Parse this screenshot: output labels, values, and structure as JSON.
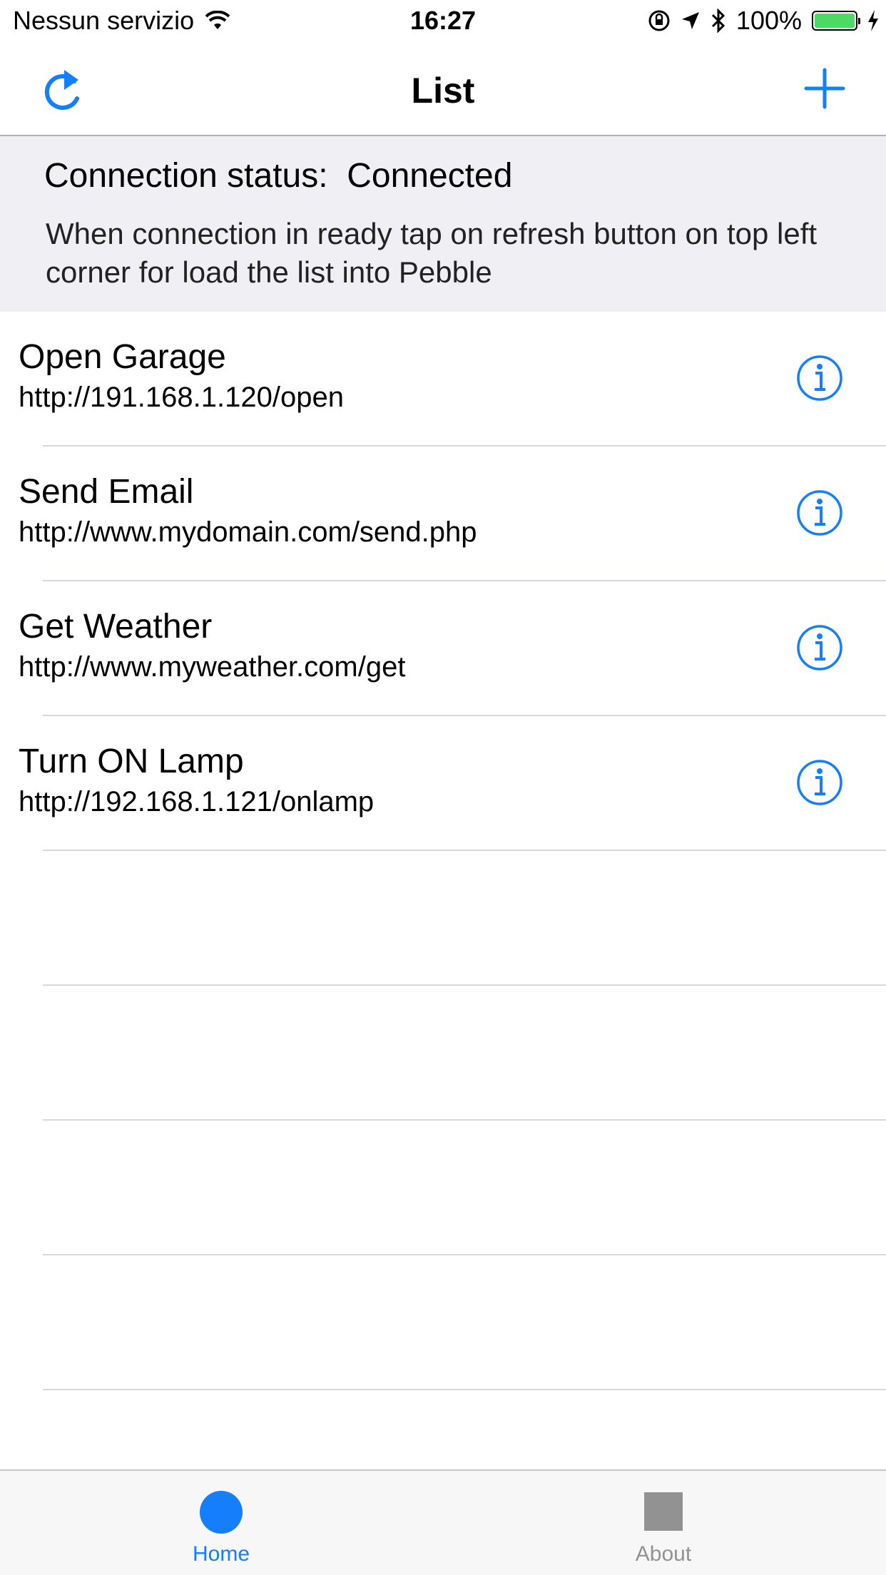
{
  "status_bar": {
    "carrier": "Nessun servizio",
    "time": "16:27",
    "battery": "100%",
    "icons": [
      "wifi-icon",
      "orientation-lock-icon",
      "location-icon",
      "bluetooth-icon",
      "battery-icon",
      "charging-icon"
    ]
  },
  "nav": {
    "title": "List",
    "left_icon": "refresh-icon",
    "right_icon": "plus-icon"
  },
  "connection": {
    "status_label": "Connection status:  Connected",
    "hint": "When connection in ready tap on refresh button on top left corner for load the list into Pebble"
  },
  "list": {
    "items": [
      {
        "title": "Open Garage",
        "url": "http://191.168.1.120/open"
      },
      {
        "title": "Send Email",
        "url": "http://www.mydomain.com/send.php"
      },
      {
        "title": "Get Weather",
        "url": "http://www.myweather.com/get"
      },
      {
        "title": "Turn ON Lamp",
        "url": "http://192.168.1.121/onlamp"
      }
    ],
    "accessory_icon": "info-icon"
  },
  "tabs": [
    {
      "label": "Home",
      "icon": "circle-icon",
      "selected": true
    },
    {
      "label": "About",
      "icon": "square-icon",
      "selected": false
    }
  ],
  "colors": {
    "accent": "#147efb",
    "panel_bg": "#efeff4",
    "battery": "#4cd964",
    "inactive_tab": "#929292"
  }
}
